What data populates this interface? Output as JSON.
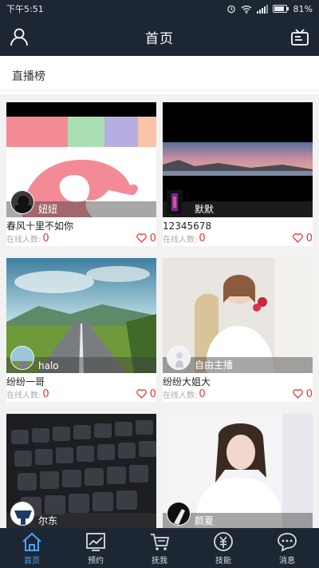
{
  "status_bar": {
    "time": "下午5:51",
    "battery": "81%"
  },
  "header": {
    "title": "首页"
  },
  "section": {
    "title": "直播榜"
  },
  "cards": [
    {
      "anchor": "妞妞",
      "title": "春风十里不如你",
      "online_label": "在线人数:",
      "online": "0",
      "likes": "0"
    },
    {
      "anchor": "默默",
      "title": "12345678",
      "online_label": "在线人数:",
      "online": "0",
      "likes": "0"
    },
    {
      "anchor": "halo",
      "title": "纷纷一哥",
      "online_label": "在线人数:",
      "online": "0",
      "likes": "0"
    },
    {
      "anchor": "自由主播",
      "title": "纷纷大姐大",
      "online_label": "在线人数:",
      "online": "0",
      "likes": "0"
    },
    {
      "anchor": "尔东",
      "title": "",
      "online_label": "",
      "online": "",
      "likes": ""
    },
    {
      "anchor": "颜夏",
      "title": "",
      "online_label": "",
      "online": "",
      "likes": ""
    }
  ],
  "tabs": [
    {
      "label": "首页",
      "icon": "home-icon",
      "active": true
    },
    {
      "label": "预约",
      "icon": "chart-icon",
      "active": false
    },
    {
      "label": "抚我",
      "icon": "cart-icon",
      "active": false
    },
    {
      "label": "技能",
      "icon": "coin-icon",
      "active": false
    },
    {
      "label": "消息",
      "icon": "chat-icon",
      "active": false
    }
  ],
  "colors": {
    "bar": "#1d2633",
    "accent": "#4aa3ff",
    "count": "#e53935"
  }
}
